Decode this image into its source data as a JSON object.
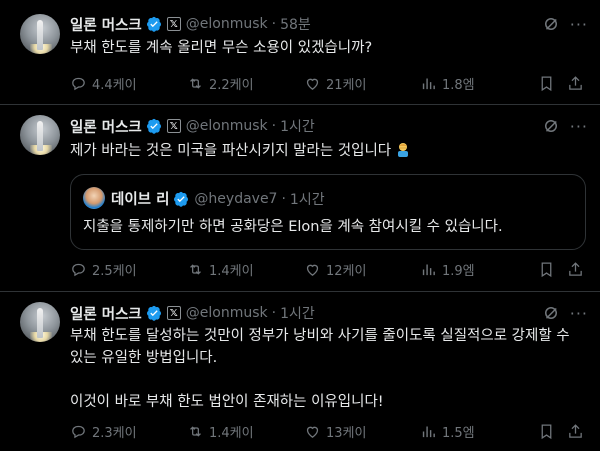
{
  "tweets": [
    {
      "author_name": "일론 머스크",
      "handle": "@elonmusk",
      "separator": "·",
      "time": "58분",
      "text": "부채 한도를 계속 올리면 무슨 소용이 있겠습니까?",
      "stats": {
        "replies": "4.4케이",
        "reposts": "2.2케이",
        "likes": "21케이",
        "views": "1.8엠"
      }
    },
    {
      "author_name": "일론 머스크",
      "handle": "@elonmusk",
      "separator": "·",
      "time": "1시간",
      "text": "제가 바라는 것은 미국을 파산시키지 말라는 것입니다",
      "emoji": "person-facepalming-emoji",
      "quote": {
        "author_name": "데이브 리",
        "handle": "@heydave7",
        "separator": "·",
        "time": "1시간",
        "text": "지출을 통제하기만 하면 공화당은 Elon을 계속 참여시킬 수 있습니다."
      },
      "stats": {
        "replies": "2.5케이",
        "reposts": "1.4케이",
        "likes": "12케이",
        "views": "1.9엠"
      }
    },
    {
      "author_name": "일론 머스크",
      "handle": "@elonmusk",
      "separator": "·",
      "time": "1시간",
      "text": "부채 한도를 달성하는 것만이 정부가 낭비와 사기를 줄이도록 실질적으로 강제할 수\n있는 유일한 방법입니다.\n\n이것이 바로 부채 한도 법안이 존재하는 이유입니다!",
      "stats": {
        "replies": "2.3케이",
        "reposts": "1.4케이",
        "likes": "13케이",
        "views": "1.5엠"
      }
    }
  ],
  "colors": {
    "background": "#000000",
    "text": "#e7e9ea",
    "muted": "#71767b",
    "border": "#2f3336",
    "verified": "#1d9bf0"
  },
  "icons": {
    "verified": "verified-badge-icon",
    "affiliate": "x-affiliate-icon",
    "grok": "grok-icon",
    "more": "more-icon",
    "reply": "reply-icon",
    "repost": "repost-icon",
    "like": "like-icon",
    "views": "views-icon",
    "bookmark": "bookmark-icon",
    "share": "share-icon"
  }
}
